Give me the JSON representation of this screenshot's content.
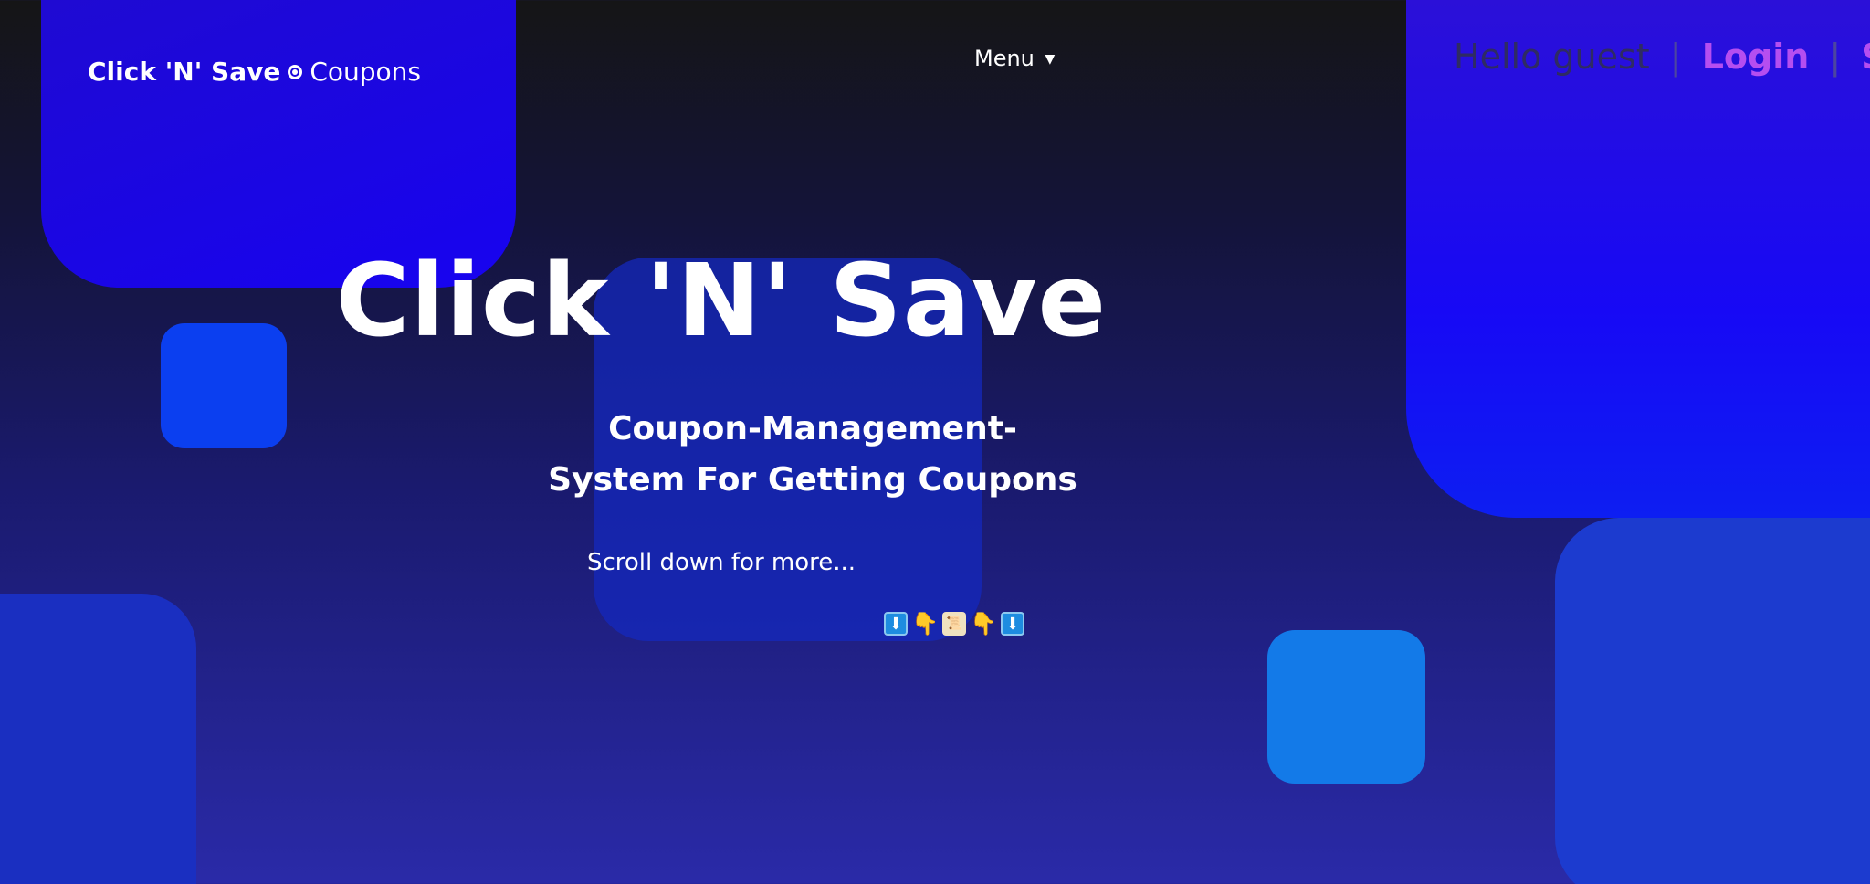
{
  "navbar": {
    "brand_name": "Click 'N' Save",
    "brand_suffix": "Coupons",
    "menu_label": "Menu",
    "greeting": "Hello guest",
    "separator": "|",
    "login_label": "Login",
    "signup_label": "Sign"
  },
  "hero": {
    "title": "Click 'N' Save",
    "subtitle": "Coupon-Management-System For Getting Coupons",
    "scroll_hint": "Scroll down for more..."
  },
  "emojis": [
    "⬇",
    "👇",
    "📜",
    "👇",
    "⬇"
  ],
  "colors": {
    "accent": "#b54ef0",
    "primary_shape": "#1703f0",
    "text": "#ffffff"
  }
}
